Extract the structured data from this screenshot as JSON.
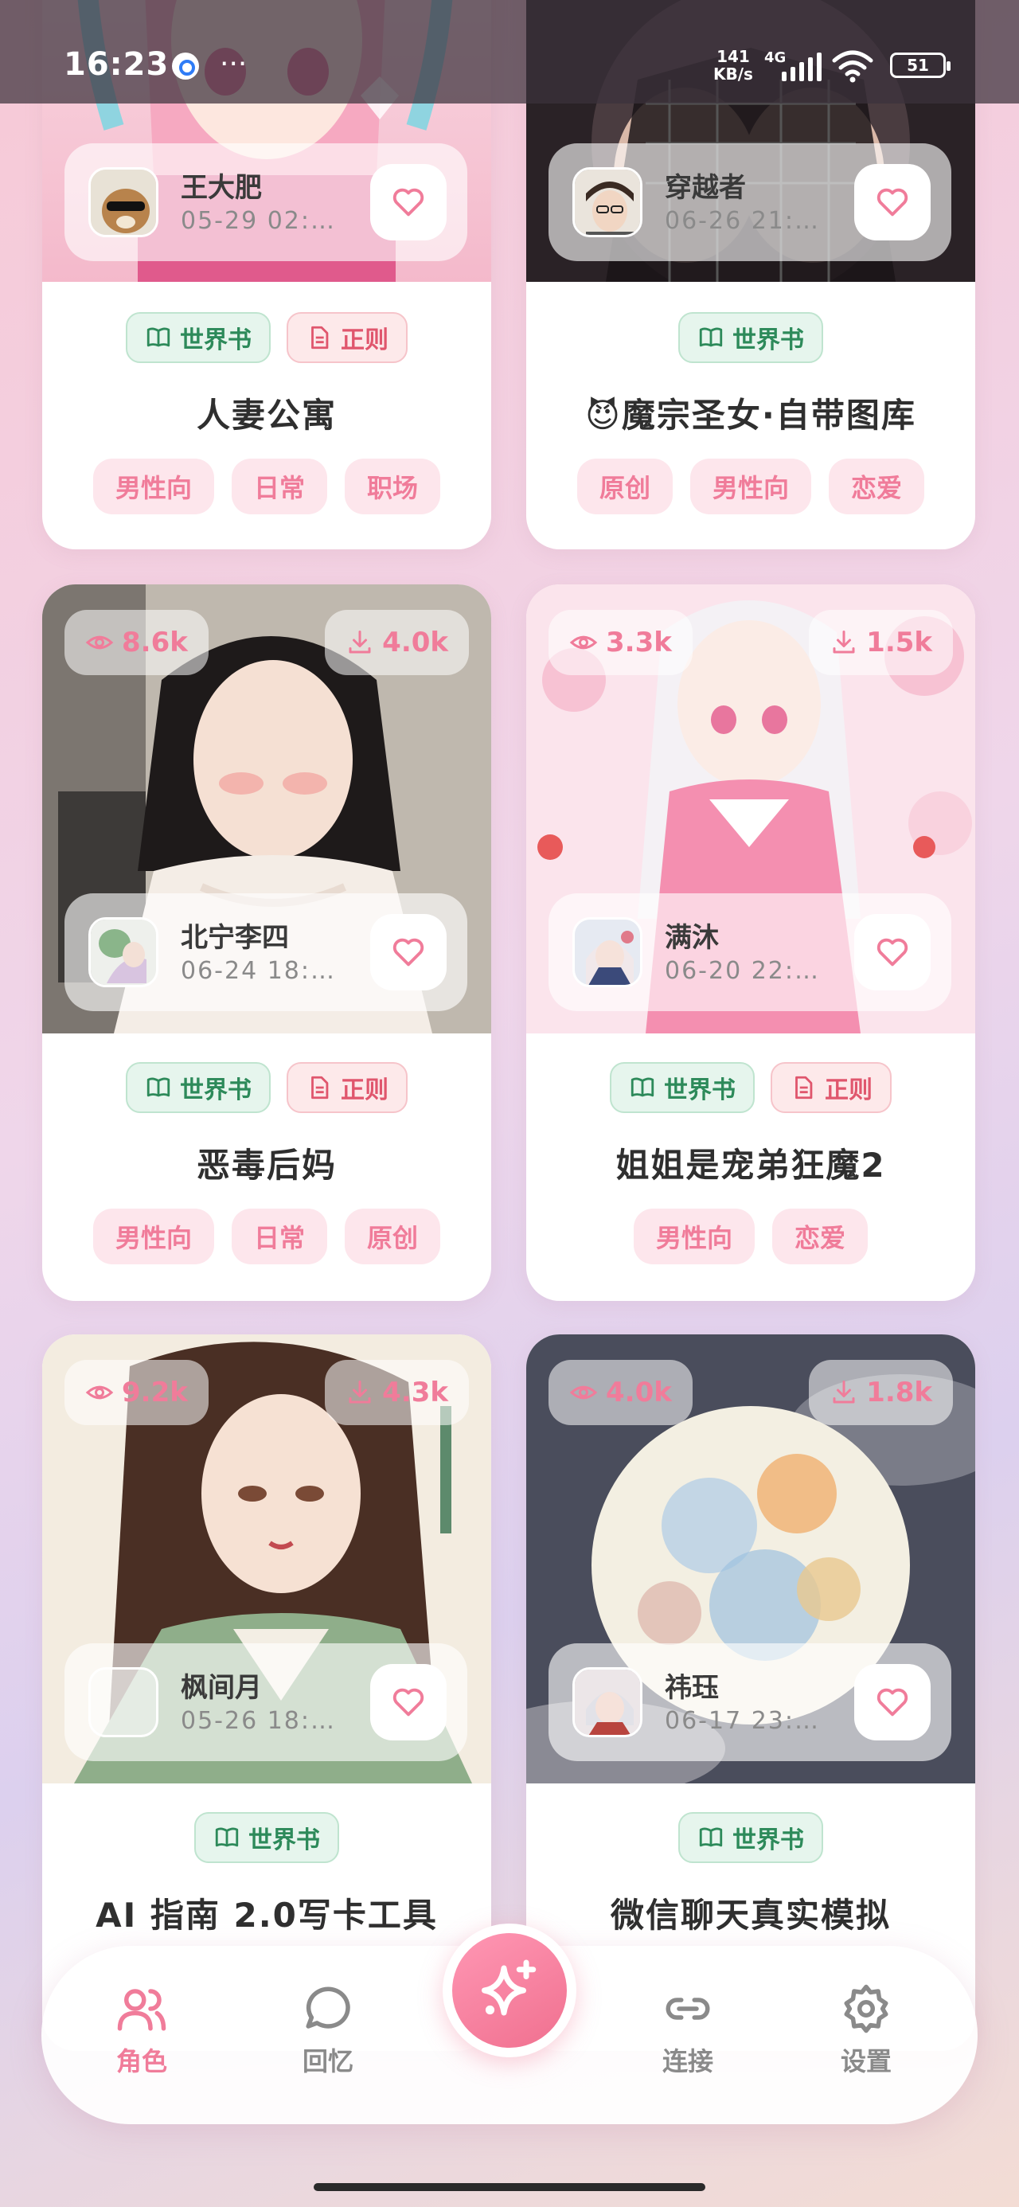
{
  "status_bar": {
    "time": "16:23",
    "more": "···",
    "net_speed_1": "141",
    "net_speed_2": "KB/s",
    "network": "4G",
    "battery": "51"
  },
  "badge_labels": {
    "world": "世界书",
    "rule": "正则"
  },
  "cards": [
    {
      "author": "王大肥",
      "date": "05-29 02:…",
      "title": "人妻公寓",
      "tags": [
        "男性向",
        "日常",
        "职场"
      ]
    },
    {
      "author": "穿越者",
      "date": "06-26 21:…",
      "title": "😈魔宗圣女·自带图库",
      "tags": [
        "原创",
        "男性向",
        "恋爱"
      ]
    },
    {
      "views": "8.6k",
      "downloads": "4.0k",
      "author": "北宁李四",
      "date": "06-24 18:…",
      "title": "恶毒后妈",
      "tags": [
        "男性向",
        "日常",
        "原创"
      ]
    },
    {
      "views": "3.3k",
      "downloads": "1.5k",
      "author": "满沐",
      "date": "06-20 22:…",
      "title": "姐姐是宠弟狂魔2",
      "tags": [
        "男性向",
        "恋爱"
      ]
    },
    {
      "views": "9.2k",
      "downloads": "4.3k",
      "author": "枫间月",
      "date": "05-26 18:…",
      "title": "AI 指南 2.0写卡工具",
      "tags": []
    },
    {
      "views": "4.0k",
      "downloads": "1.8k",
      "author": "祎珏",
      "date": "06-17 23:…",
      "title": "微信聊天真实模拟",
      "tags": []
    }
  ],
  "nav": {
    "characters": "角色",
    "memories": "回忆",
    "connect": "连接",
    "settings": "设置"
  },
  "colors": {
    "accent": "#f07c9a",
    "world_badge": "#2d8a5a",
    "rule_badge": "#e0566d"
  }
}
